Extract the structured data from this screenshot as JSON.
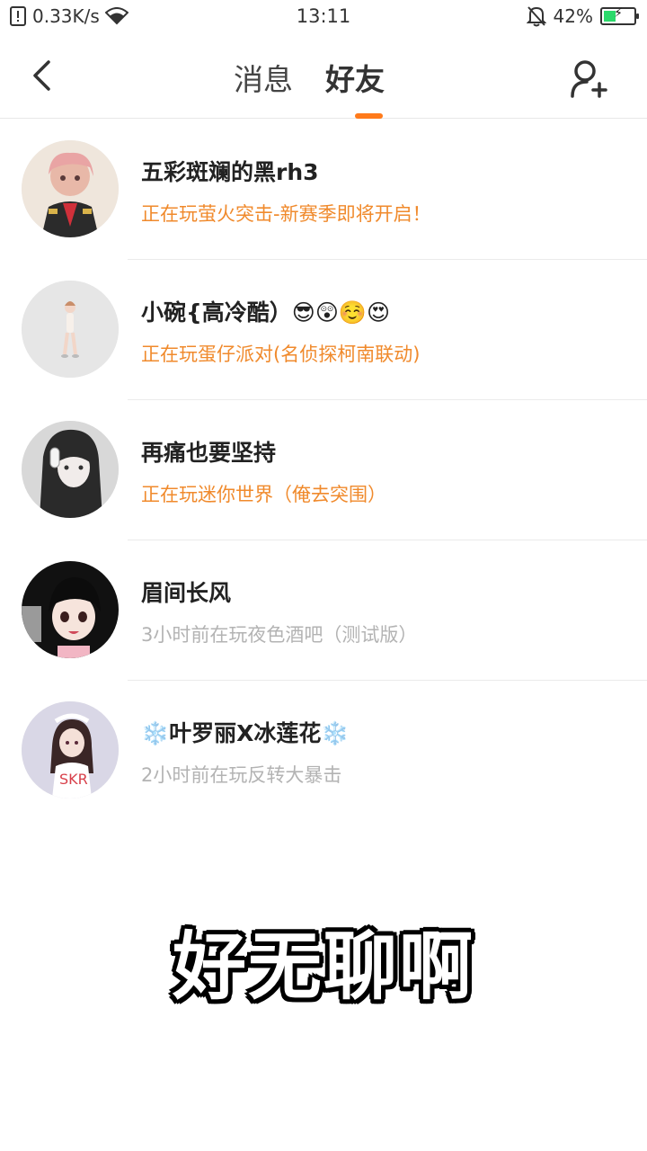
{
  "status_bar": {
    "speed": "0.33K/s",
    "time": "13:11",
    "battery": "42%",
    "battery_level": 0.42
  },
  "header": {
    "tabs": [
      {
        "label": "消息",
        "active": false
      },
      {
        "label": "好友",
        "active": true
      }
    ]
  },
  "friends": [
    {
      "name": "五彩斑斓的黑rh3",
      "status": "正在玩萤火突击-新赛季即将开启！",
      "state": "playing"
    },
    {
      "name": "小碗{高冷酷）😎😲☺️😍",
      "status": "正在玩蛋仔派对(名侦探柯南联动)",
      "state": "playing"
    },
    {
      "name": "再痛也要坚持",
      "status": "正在玩迷你世界（俺去突围）",
      "state": "playing"
    },
    {
      "name": "眉间长风",
      "status": "3小时前在玩夜色酒吧（测试版）",
      "state": "idle"
    },
    {
      "name_prefix": "❄️",
      "name_main": "叶罗丽X冰莲花",
      "name_suffix": "❄️",
      "status": "2小时前在玩反转大暴击",
      "state": "idle"
    }
  ],
  "caption": "好无聊啊",
  "colors": {
    "accent": "#ff7a1a",
    "playing_status": "#f08a2c",
    "idle_status": "#b3b3b3"
  }
}
